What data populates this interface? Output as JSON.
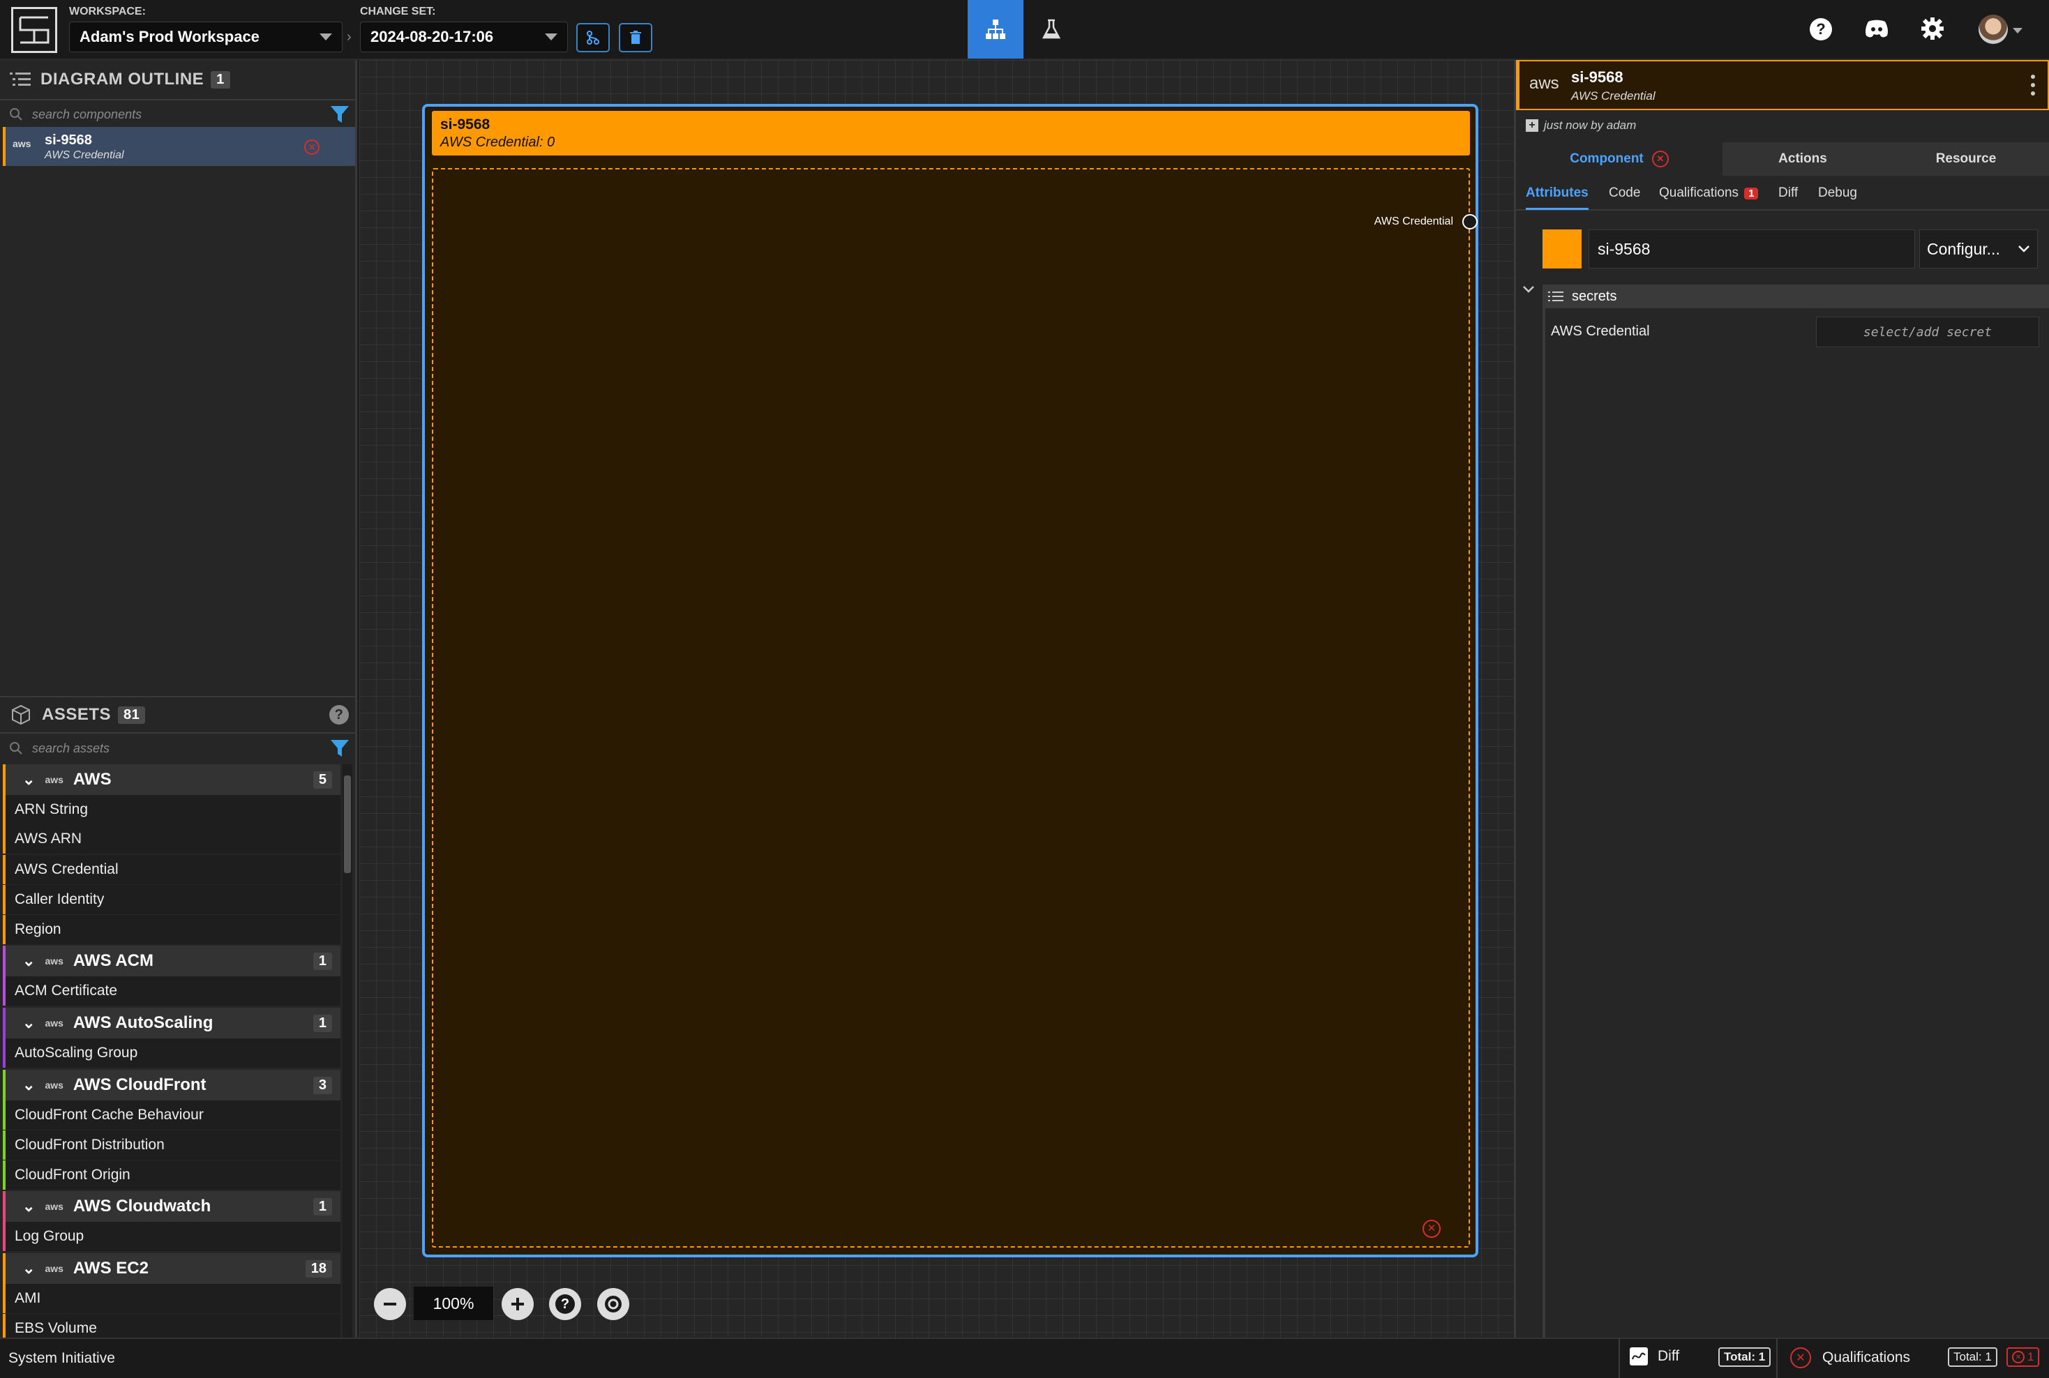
{
  "topbar": {
    "workspace_label": "WORKSPACE:",
    "workspace_value": "Adam's Prod Workspace",
    "changeset_label": "CHANGE SET:",
    "changeset_value": "2024-08-20-17:06"
  },
  "outline": {
    "title": "DIAGRAM OUTLINE",
    "count": "1",
    "search_placeholder": "search components",
    "item": {
      "name": "si-9568",
      "type": "AWS Credential"
    }
  },
  "assets": {
    "title": "ASSETS",
    "count": "81",
    "search_placeholder": "search assets",
    "groups": [
      {
        "name": "AWS",
        "count": "5",
        "color": "#ff9900",
        "items": [
          "ARN String",
          "AWS ARN",
          "AWS Credential",
          "Caller Identity",
          "Region"
        ]
      },
      {
        "name": "AWS ACM",
        "count": "1",
        "color": "#b84dd9",
        "items": [
          "ACM Certificate"
        ]
      },
      {
        "name": "AWS AutoScaling",
        "count": "1",
        "color": "#9a3fd6",
        "items": [
          "AutoScaling Group"
        ]
      },
      {
        "name": "AWS CloudFront",
        "count": "3",
        "color": "#7ed321",
        "items": [
          "CloudFront Cache Behaviour",
          "CloudFront Distribution",
          "CloudFront Origin"
        ]
      },
      {
        "name": "AWS Cloudwatch",
        "count": "1",
        "color": "#e8467c",
        "items": [
          "Log Group"
        ]
      },
      {
        "name": "AWS EC2",
        "count": "18",
        "color": "#ff9900",
        "items": [
          "AMI",
          "EBS Volume"
        ]
      }
    ]
  },
  "canvas": {
    "node_title": "si-9568",
    "node_subtitle": "AWS Credential: 0",
    "socket_label": "AWS Credential",
    "zoom": "100%"
  },
  "details": {
    "name": "si-9568",
    "type": "AWS Credential",
    "history": "just now by adam",
    "main_tabs": [
      "Component",
      "Actions",
      "Resource"
    ],
    "sub_tabs": [
      "Attributes",
      "Code",
      "Qualifications",
      "Diff",
      "Debug"
    ],
    "qualifications_badge": "1",
    "name_field": "si-9568",
    "config_select": "Configur...",
    "section": "secrets",
    "attr_label": "AWS Credential",
    "attr_placeholder": "select/add secret",
    "accent": "#ff9900"
  },
  "status": {
    "brand": "System Initiative",
    "diff_label": "Diff",
    "diff_total": "Total: 1",
    "qual_label": "Qualifications",
    "qual_total": "Total: 1",
    "qual_fail": "1"
  },
  "aws_logo_text": "aws"
}
